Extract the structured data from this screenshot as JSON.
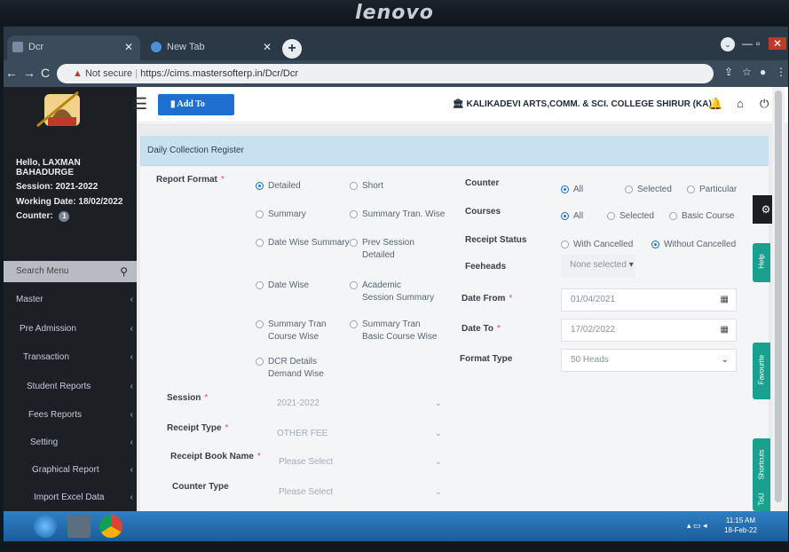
{
  "brand": "lenovo",
  "browser": {
    "tabs": [
      {
        "label": "Dcr",
        "active": true
      },
      {
        "label": "New Tab",
        "active": false
      }
    ],
    "new_tab_symbol": "+",
    "security_label": "Not secure",
    "url": "https://cims.mastersofterp.in/Dcr/Dcr"
  },
  "topbar": {
    "favourite_label": "Add To Favourite",
    "college": "KALIKADEVI ARTS,COMM. & SCI. COLLEGE SHIRUR (KA)"
  },
  "sidebar": {
    "greeting": "Hello, LAXMAN",
    "user_last": "BAHADURGE",
    "session": "Session: 2021-2022",
    "working_date": "Working Date: 18/02/2022",
    "counter_label": "Counter:",
    "counter_value": "1",
    "search_placeholder": "Search Menu",
    "items": [
      {
        "label": "Master"
      },
      {
        "label": "Pre Admission"
      },
      {
        "label": "Transaction"
      },
      {
        "label": "Student Reports"
      },
      {
        "label": "Fees Reports"
      },
      {
        "label": "Setting"
      },
      {
        "label": "Graphical Report"
      },
      {
        "label": "Import Excel Data"
      }
    ]
  },
  "page": {
    "title": "Daily Collection Register",
    "report_format_label": "Report Format",
    "report_formats": [
      {
        "label": "Detailed",
        "selected": true
      },
      {
        "label": "Short",
        "selected": false
      },
      {
        "label": "Summary",
        "selected": false
      },
      {
        "label": "Summary Tran. Wise",
        "selected": false
      },
      {
        "label": "Date Wise Summary",
        "selected": false
      },
      {
        "label": "Prev Session Detailed",
        "selected": false
      },
      {
        "label": "Date Wise",
        "selected": false
      },
      {
        "label": "Academic Session Summary",
        "selected": false
      },
      {
        "label": "Summary Tran Course Wise",
        "selected": false
      },
      {
        "label": "Summary Tran Basic Course Wise",
        "selected": false
      },
      {
        "label": "DCR Details Demand Wise",
        "selected": false
      }
    ],
    "counter_label": "Counter",
    "counter_options": [
      {
        "label": "All",
        "selected": true
      },
      {
        "label": "Selected",
        "selected": false
      },
      {
        "label": "Particular",
        "selected": false
      }
    ],
    "courses_label": "Courses",
    "courses_options": [
      {
        "label": "All",
        "selected": true
      },
      {
        "label": "Selected",
        "selected": false
      },
      {
        "label": "Basic Course",
        "selected": false
      }
    ],
    "receipt_status_label": "Receipt Status",
    "receipt_status_options": [
      {
        "label": "With Cancelled",
        "selected": false
      },
      {
        "label": "Without Cancelled",
        "selected": true
      }
    ],
    "feeheads_label": "Feeheads",
    "feeheads_value": "None selected",
    "date_from_label": "Date From",
    "date_from_value": "01/04/2021",
    "date_to_label": "Date To",
    "date_to_value": "17/02/2022",
    "format_type_label": "Format Type",
    "format_type_value": "50 Heads",
    "session_label": "Session",
    "session_value": "2021-2022",
    "receipt_type_label": "Receipt Type",
    "receipt_type_value": "OTHER FEE",
    "receipt_book_label": "Receipt Book Name",
    "receipt_book_value": "Please Select",
    "counter_type_label": "Counter Type",
    "counter_type_value": "Please Select"
  },
  "side_tabs": [
    {
      "label": "Help"
    },
    {
      "label": "Favourite"
    },
    {
      "label": "Shortcuts"
    },
    {
      "label": "ToU"
    }
  ],
  "taskbar": {
    "time": "11:15 AM",
    "date": "18-Feb-22"
  }
}
